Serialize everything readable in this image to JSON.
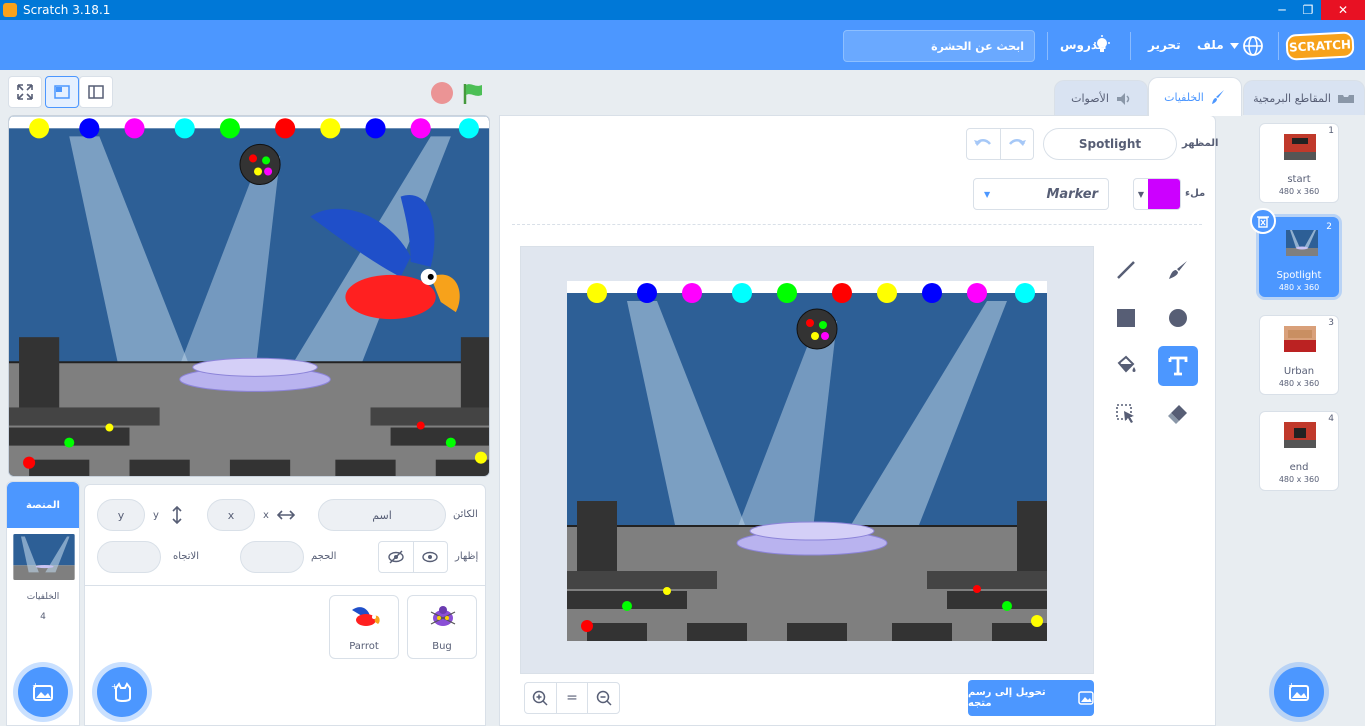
{
  "window": {
    "title": "Scratch 3.18.1",
    "minimize": "─",
    "maximize": "❐",
    "close": "✕"
  },
  "menu": {
    "logo": "SCRATCH",
    "file": "ملف",
    "edit": "تحرير",
    "tutorials": "الدروس",
    "search_placeholder": "ابحث عن الحشرة"
  },
  "tabs": {
    "code": "المقاطع البرمجية",
    "backdrops": "الخلفيات",
    "sounds": "الأصوات"
  },
  "sprite_info": {
    "sprite_label": "الكائن",
    "name_placeholder": "اسم",
    "x_label": "x",
    "x_value": "x",
    "y_label": "y",
    "y_value": "y",
    "show_label": "إظهار",
    "size_label": "الحجم",
    "direction_label": "الاتجاه"
  },
  "sprites": [
    {
      "name": "Bug"
    },
    {
      "name": "Parrot"
    }
  ],
  "stage_target": {
    "header": "المنصة",
    "backdrops_label": "الخلفيات",
    "backdrops_count": "4"
  },
  "paint_editor": {
    "costume_label": "المظهر",
    "costume_name": "Spotlight",
    "fill_label": "ملء",
    "fill_color": "#cc00ff",
    "font": "Marker",
    "convert_label": "تحويل إلى رسم متجه",
    "zoom_in": "+",
    "zoom_reset": "=",
    "zoom_out": "−"
  },
  "costumes": [
    {
      "num": "1",
      "name": "start",
      "size": "480 x 360"
    },
    {
      "num": "2",
      "name": "Spotlight",
      "size": "480 x 360",
      "selected": true
    },
    {
      "num": "3",
      "name": "Urban",
      "size": "480 x 360"
    },
    {
      "num": "4",
      "name": "end",
      "size": "480 x 360"
    }
  ],
  "colors": {
    "accent": "#4c97ff",
    "menubar": "#4c97ff",
    "stage_bg": "#2d5f96",
    "floor": "#808080"
  }
}
